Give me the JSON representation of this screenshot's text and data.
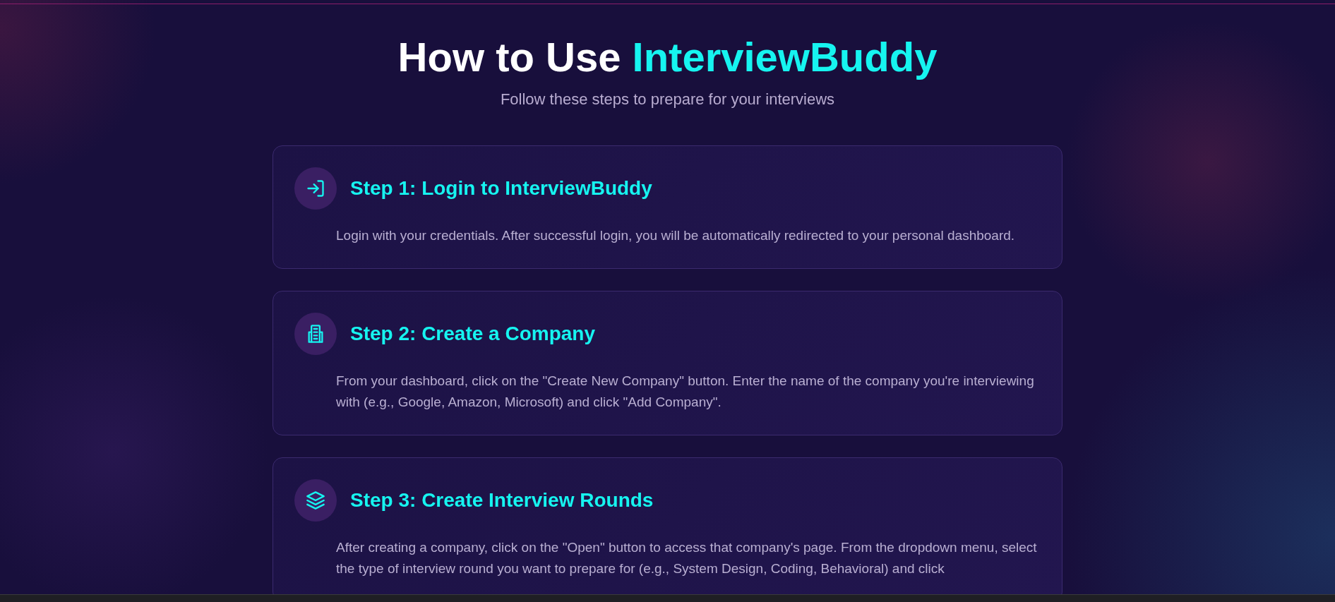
{
  "header": {
    "title": "How to Use ",
    "title_brand": "InterviewBuddy",
    "subtitle": "Follow these steps to prepare for your interviews"
  },
  "steps": [
    {
      "title": "Step 1: Login to InterviewBuddy",
      "text": "Login with your credentials. After successful login, you will be automatically redirected to your personal dashboard."
    },
    {
      "title": "Step 2: Create a Company",
      "text": "From your dashboard, click on the \"Create New Company\" button. Enter the name of the company you're interviewing with (e.g., Google, Amazon, Microsoft) and click \"Add Company\"."
    },
    {
      "title": "Step 3: Create Interview Rounds",
      "text": "After creating a company, click on the \"Open\" button to access that company's page. From the dropdown menu, select the type of interview round you want to prepare for (e.g., System Design, Coding, Behavioral) and click"
    }
  ]
}
